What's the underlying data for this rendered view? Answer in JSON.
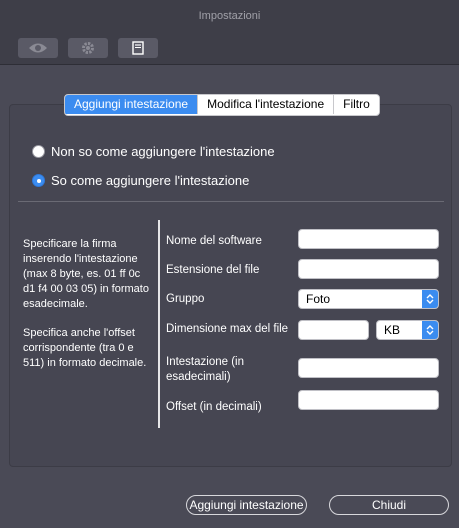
{
  "window": {
    "title": "Impostazioni"
  },
  "toolbar": {
    "icons": [
      "eye-icon",
      "gear-icon",
      "document-icon"
    ]
  },
  "tabs": [
    {
      "label": "Aggiungi intestazione",
      "active": true
    },
    {
      "label": "Modifica l'intestazione",
      "active": false
    },
    {
      "label": "Filtro",
      "active": false
    }
  ],
  "radios": [
    {
      "label": "Non so come aggiungere l'intestazione",
      "checked": false
    },
    {
      "label": "So come aggiungere l'intestazione",
      "checked": true
    }
  ],
  "help": {
    "paragraph1": "Specificare la firma inserendo l'intestazione (max 8 byte, es. 01 ff 0c d1 f4 00 03 05) in formato esadecimale.",
    "paragraph2": "Specifica anche l'offset corrispondente (tra 0 e 511) in formato decimale."
  },
  "form": {
    "software_name": {
      "label": "Nome del software",
      "value": ""
    },
    "file_extension": {
      "label": "Estensione del file",
      "value": ""
    },
    "group": {
      "label": "Gruppo",
      "value": "Foto"
    },
    "max_size": {
      "label": "Dimensione max del file",
      "value": "",
      "unit": "KB"
    },
    "header_hex": {
      "label": "Intestazione (in esadecimali)",
      "value": ""
    },
    "offset_dec": {
      "label": "Offset (in decimali)",
      "value": ""
    }
  },
  "buttons": {
    "add": "Aggiungi intestazione",
    "close": "Chiudi"
  },
  "colors": {
    "accent": "#3b8cf0",
    "background": "#4a4a56",
    "titlebar": "#3e3e48"
  }
}
